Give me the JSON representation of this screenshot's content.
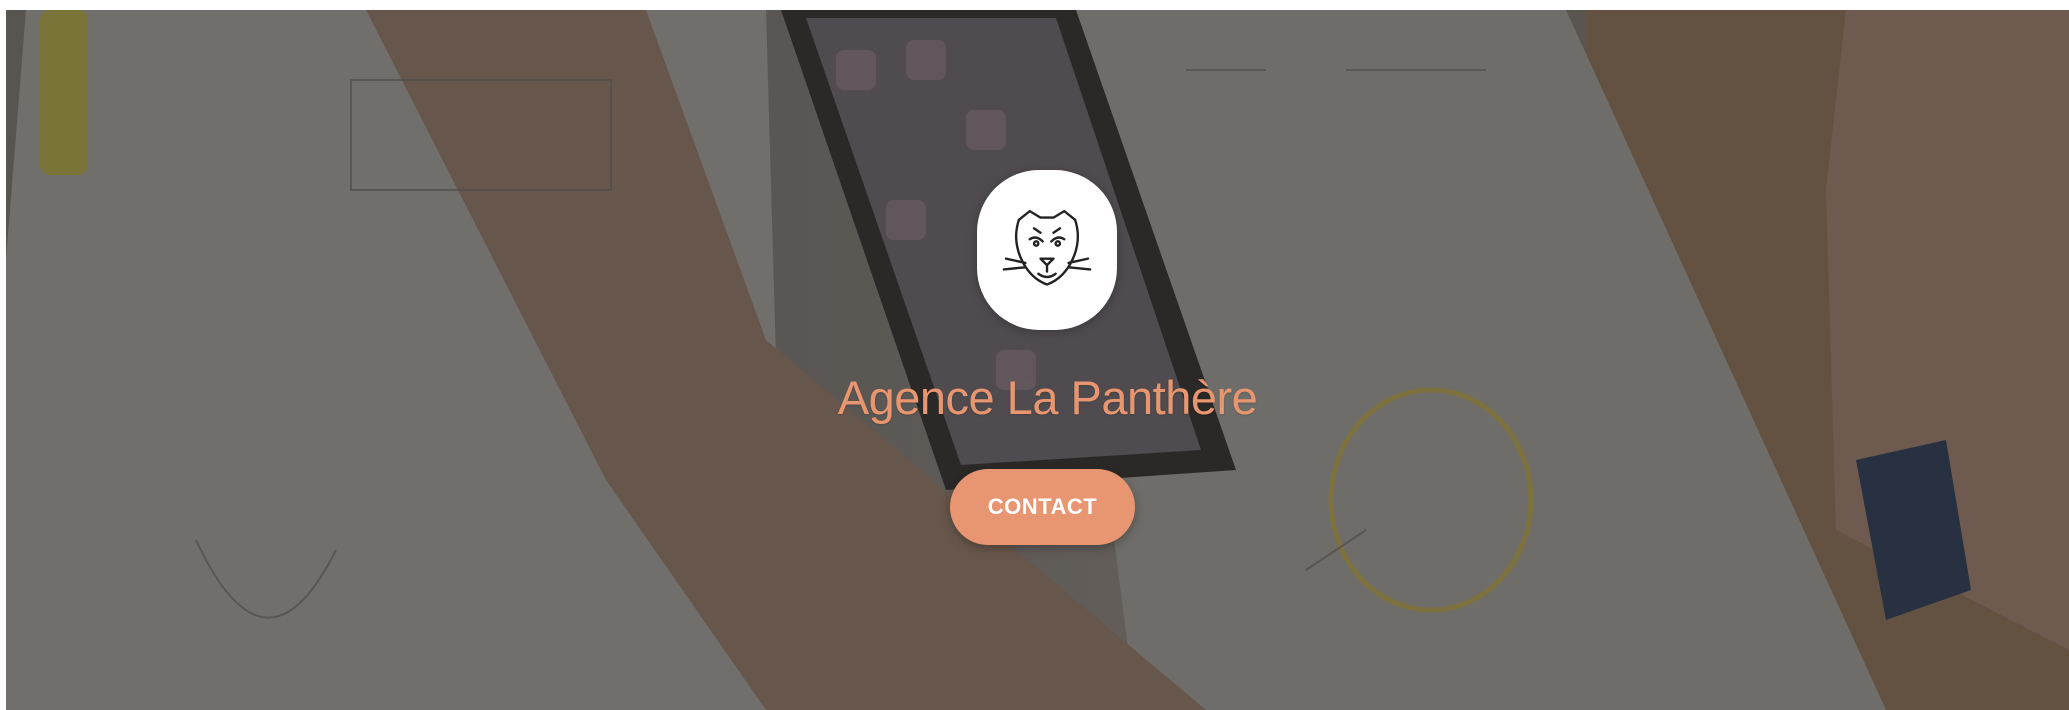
{
  "hero": {
    "title": "Agence La Panthère",
    "contact_label": "CONTACT",
    "logo_icon": "panther-icon",
    "colors": {
      "accent": "#e8966f",
      "button_bg": "#e89572",
      "button_text": "#ffffff",
      "logo_bg": "#ffffff"
    }
  }
}
